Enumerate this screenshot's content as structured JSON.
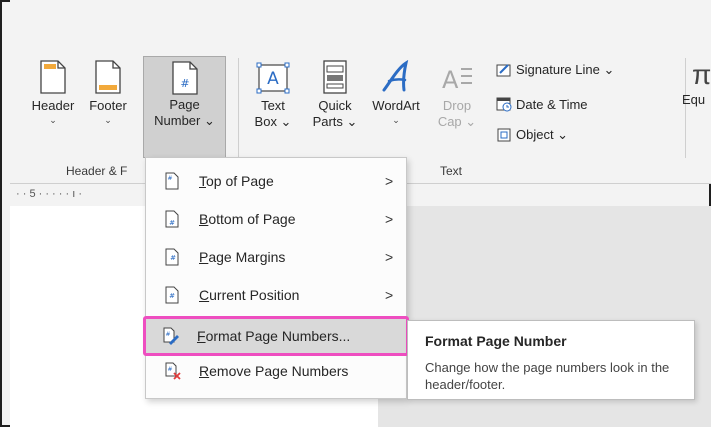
{
  "ribbon": {
    "header": {
      "label": "Header",
      "caret": "⌄"
    },
    "footer": {
      "label": "Footer",
      "caret": "⌄"
    },
    "page_number": {
      "line1": "Page",
      "line2": "Number ⌄"
    },
    "text_box": {
      "line1": "Text",
      "line2": "Box ⌄"
    },
    "quick_parts": {
      "line1": "Quick",
      "line2": "Parts ⌄"
    },
    "wordart": {
      "label": "WordArt",
      "caret": "⌄"
    },
    "drop_cap": {
      "line1": "Drop",
      "line2": "Cap ⌄"
    },
    "signature_line": "Signature Line ⌄",
    "date_time": "Date & Time",
    "object": "Object ⌄",
    "equation_partial": "Equ",
    "group_header_footer": "Header & F",
    "group_text": "Text"
  },
  "ruler": {
    "text": "· · 5 · · · · · ı ·"
  },
  "menu": {
    "items": [
      {
        "label": "Top of Page",
        "mnemonic": "T",
        "rest": "op of Page",
        "arrow": ">"
      },
      {
        "label": "Bottom of Page",
        "mnemonic": "B",
        "rest": "ottom of Page",
        "arrow": ">"
      },
      {
        "label": "Page Margins",
        "mnemonic": "P",
        "rest": "age Margins",
        "arrow": ">"
      },
      {
        "label": "Current Position",
        "mnemonic": "C",
        "rest": "urrent Position",
        "arrow": ">"
      },
      {
        "label": "Format Page Numbers...",
        "mnemonic": "F",
        "rest": "ormat Page Numbers...",
        "arrow": ""
      },
      {
        "label": "Remove Page Numbers",
        "mnemonic": "R",
        "rest": "emove Page Numbers",
        "arrow": ""
      }
    ]
  },
  "tooltip": {
    "title": "Format Page Number",
    "body": "Change how the page numbers look in the header/footer."
  },
  "colors": {
    "highlight_border": "#ee4ec0",
    "accent_blue": "#2b6cc4"
  }
}
